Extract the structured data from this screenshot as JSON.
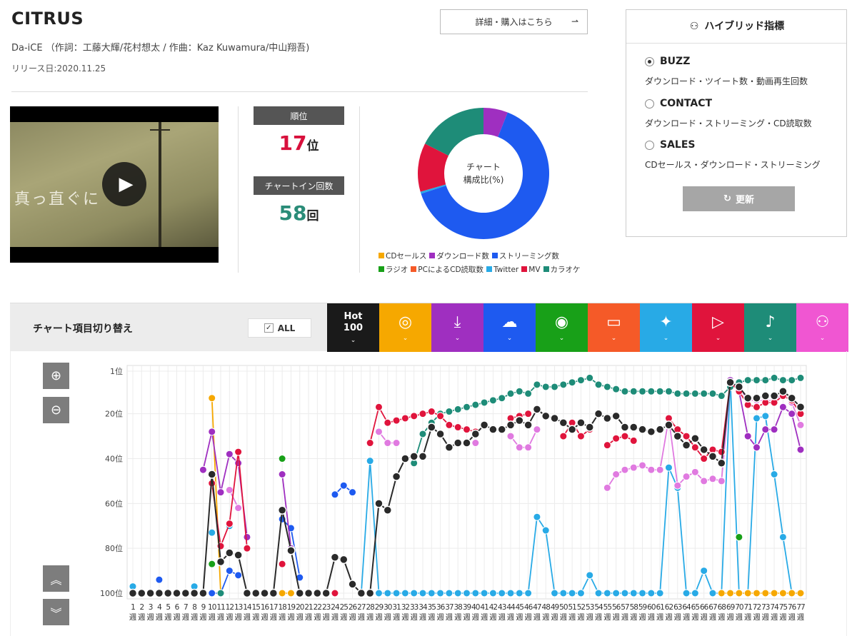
{
  "song": {
    "title": "CITRUS",
    "credits": "Da-iCE （作詞：工藤大輝/花村想太 / 作曲：Kaz Kuwamura/中山翔吾)",
    "release": "リリース日:2020.11.25",
    "buy_label": "詳細・購入はこちら",
    "buy_arrow": "⇀"
  },
  "video": {
    "overlay_text": "真っ直ぐに",
    "play_glyph": "▶"
  },
  "stats": {
    "rank_label": "順位",
    "rank_value": "17",
    "rank_unit": "位",
    "rank_color": "#d8103c",
    "count_label": "チャートイン回数",
    "count_value": "58",
    "count_unit": "回",
    "count_color": "#2a8c78"
  },
  "donut": {
    "center_line1": "チャート",
    "center_line2": "構成比(%)",
    "segments": [
      {
        "name": "CDセールス",
        "color": "#f6a800",
        "value": 0
      },
      {
        "name": "ダウンロード数",
        "color": "#9f2fc0",
        "value": 6
      },
      {
        "name": "ストリーミング数",
        "color": "#1e5af0",
        "value": 64
      },
      {
        "name": "ラジオ",
        "color": "#18a018",
        "value": 0
      },
      {
        "name": "PCによるCD読取数",
        "color": "#f55a28",
        "value": 0
      },
      {
        "name": "Twitter",
        "color": "#28aae6",
        "value": 0.5
      },
      {
        "name": "MV",
        "color": "#e0143c",
        "value": 12
      },
      {
        "name": "カラオケ",
        "color": "#1e8c78",
        "value": 17.5
      }
    ]
  },
  "panel": {
    "title": "ハイブリッド指標",
    "options": [
      {
        "label": "BUZZ",
        "desc": "ダウンロード・ツイート数・動画再生回数",
        "selected": true
      },
      {
        "label": "CONTACT",
        "desc": "ダウンロード・ストリーミング・CD読取数",
        "selected": false
      },
      {
        "label": "SALES",
        "desc": "CDセールス・ダウンロード・ストリーミング",
        "selected": false
      }
    ],
    "refresh_label": "更新",
    "refresh_icon": "↻"
  },
  "toggle": {
    "title": "チャート項目切り替え",
    "all_label": "ALL",
    "all_check": "✓",
    "hot_line1": "Hot",
    "hot_line2": "100",
    "chevron": "⌄",
    "tiles": [
      {
        "key": "hot100",
        "color": "#1a1a1a",
        "icon": ""
      },
      {
        "key": "cd-sales",
        "color": "#f6a800",
        "icon": "◎"
      },
      {
        "key": "download",
        "color": "#9f2fc0",
        "icon": "⤓"
      },
      {
        "key": "streaming",
        "color": "#1e5af0",
        "icon": "☁"
      },
      {
        "key": "radio",
        "color": "#18a018",
        "icon": "◉"
      },
      {
        "key": "pc-cd",
        "color": "#f55a28",
        "icon": "▭"
      },
      {
        "key": "twitter",
        "color": "#28aae6",
        "icon": "✦"
      },
      {
        "key": "mv",
        "color": "#e0143c",
        "icon": "▷"
      },
      {
        "key": "karaoke",
        "color": "#1e8c78",
        "icon": "♪"
      },
      {
        "key": "hybrid",
        "color": "#f056d2",
        "icon": "⚇"
      }
    ]
  },
  "controls": {
    "zoom_in": "⊕",
    "zoom_out": "⊖",
    "scroll_up": "︽",
    "scroll_down": "︾"
  },
  "chart_data": {
    "type": "line",
    "y_reversed": true,
    "ylim": [
      1,
      100
    ],
    "ytick_labels": [
      "1位",
      "20位",
      "40位",
      "60位",
      "80位",
      "100位"
    ],
    "ytick_values": [
      1,
      20,
      40,
      60,
      80,
      100
    ],
    "x_labels": [
      "1週",
      "2週",
      "3週",
      "4週",
      "5週",
      "6週",
      "7週",
      "8週",
      "9週",
      "10週",
      "11週",
      "12週",
      "13週",
      "14週",
      "15週",
      "16週",
      "17週",
      "18週",
      "19週",
      "20週",
      "21週",
      "22週",
      "23週",
      "24週",
      "25週",
      "26週",
      "27週",
      "28週",
      "29週",
      "30週",
      "31週",
      "32週",
      "33週",
      "34週",
      "35週",
      "36週",
      "37週",
      "38週",
      "39週",
      "40週",
      "41週",
      "42週",
      "43週",
      "44週",
      "45週",
      "46週",
      "47週",
      "48週",
      "49週",
      "50週",
      "51週",
      "52週",
      "53週",
      "54週",
      "55週",
      "56週",
      "57週",
      "58週",
      "59週",
      "60週",
      "61週",
      "62週",
      "63週",
      "64週",
      "65週",
      "66週",
      "67週",
      "68週",
      "69週",
      "70週",
      "71週",
      "72週",
      "73週",
      "74週",
      "75週",
      "76週",
      "77週"
    ],
    "series": [
      {
        "key": "hot100",
        "color": "#2a2a2a",
        "values": [
          100,
          100,
          100,
          100,
          100,
          100,
          100,
          100,
          100,
          47,
          86,
          82,
          83,
          100,
          100,
          100,
          100,
          63,
          81,
          100,
          100,
          100,
          100,
          84,
          85,
          96,
          100,
          100,
          60,
          63,
          48,
          40,
          39,
          39,
          26,
          29,
          35,
          33,
          33,
          29,
          25,
          27,
          27,
          25,
          23,
          25,
          18,
          21,
          22,
          24,
          27,
          24,
          26,
          20,
          22,
          21,
          26,
          26,
          27,
          28,
          27,
          25,
          30,
          34,
          31,
          36,
          39,
          42,
          6,
          8,
          13,
          13,
          12,
          12,
          10,
          13,
          17
        ]
      },
      {
        "key": "cd-sales",
        "color": "#f6a800",
        "values": [
          null,
          null,
          null,
          null,
          null,
          null,
          null,
          null,
          null,
          13,
          100,
          null,
          null,
          null,
          null,
          null,
          null,
          100,
          100,
          null,
          null,
          null,
          null,
          null,
          null,
          null,
          null,
          null,
          null,
          null,
          null,
          null,
          null,
          null,
          null,
          null,
          null,
          null,
          null,
          null,
          null,
          null,
          null,
          null,
          null,
          null,
          null,
          null,
          null,
          null,
          null,
          null,
          null,
          null,
          null,
          null,
          null,
          null,
          null,
          null,
          null,
          null,
          null,
          null,
          null,
          null,
          null,
          100,
          100,
          100,
          100,
          100,
          100,
          100,
          100,
          100,
          100
        ]
      },
      {
        "key": "download",
        "color": "#9f2fc0",
        "values": [
          null,
          null,
          null,
          null,
          null,
          null,
          null,
          null,
          45,
          28,
          55,
          38,
          42,
          75,
          null,
          null,
          null,
          47,
          80,
          null,
          null,
          null,
          null,
          null,
          null,
          null,
          null,
          null,
          null,
          null,
          null,
          null,
          null,
          null,
          null,
          null,
          null,
          null,
          null,
          null,
          null,
          null,
          null,
          null,
          null,
          null,
          null,
          null,
          null,
          null,
          null,
          null,
          null,
          null,
          null,
          null,
          null,
          null,
          null,
          null,
          null,
          null,
          null,
          null,
          null,
          null,
          null,
          null,
          5,
          10,
          30,
          35,
          27,
          27,
          17,
          20,
          36
        ]
      },
      {
        "key": "streaming",
        "color": "#1e5af0",
        "values": [
          null,
          null,
          null,
          94,
          null,
          null,
          null,
          null,
          null,
          100,
          100,
          90,
          92,
          null,
          null,
          null,
          null,
          67,
          71,
          93,
          null,
          null,
          null,
          56,
          52,
          55,
          null,
          null,
          null,
          null,
          null,
          null,
          null,
          null,
          null,
          null,
          null,
          null,
          null,
          null,
          null,
          null,
          null,
          null,
          null,
          null,
          null,
          null,
          null,
          null,
          null,
          null,
          null,
          null,
          null,
          null,
          null,
          null,
          null,
          null,
          null,
          null,
          null,
          null,
          null,
          null,
          null,
          null,
          7,
          null,
          null,
          null,
          null,
          null,
          null,
          null,
          null
        ]
      },
      {
        "key": "radio",
        "color": "#18a018",
        "values": [
          null,
          null,
          null,
          null,
          null,
          null,
          null,
          null,
          null,
          87,
          null,
          null,
          null,
          null,
          null,
          null,
          null,
          40,
          null,
          null,
          null,
          null,
          null,
          null,
          null,
          null,
          null,
          null,
          null,
          null,
          null,
          null,
          null,
          null,
          null,
          null,
          null,
          null,
          null,
          null,
          null,
          null,
          null,
          null,
          null,
          null,
          null,
          null,
          null,
          null,
          null,
          null,
          null,
          null,
          null,
          null,
          null,
          null,
          null,
          null,
          null,
          null,
          null,
          null,
          null,
          null,
          null,
          null,
          null,
          75,
          null,
          null,
          null,
          null,
          null,
          null,
          null
        ]
      },
      {
        "key": "twitter",
        "color": "#28aae6",
        "values": [
          97,
          null,
          null,
          null,
          null,
          null,
          null,
          97,
          null,
          73,
          null,
          70,
          null,
          null,
          null,
          null,
          null,
          null,
          null,
          null,
          null,
          null,
          null,
          null,
          null,
          null,
          100,
          41,
          100,
          100,
          100,
          100,
          100,
          100,
          100,
          100,
          100,
          100,
          100,
          100,
          100,
          100,
          100,
          100,
          100,
          100,
          66,
          72,
          100,
          100,
          100,
          100,
          92,
          100,
          100,
          100,
          100,
          100,
          100,
          100,
          100,
          44,
          53,
          100,
          100,
          90,
          100,
          100,
          5,
          100,
          100,
          22,
          21,
          47,
          75,
          100,
          100
        ]
      },
      {
        "key": "mv",
        "color": "#e0143c",
        "values": [
          null,
          null,
          null,
          null,
          null,
          null,
          null,
          null,
          null,
          51,
          79,
          69,
          37,
          80,
          null,
          null,
          null,
          87,
          null,
          null,
          null,
          null,
          null,
          100,
          null,
          null,
          null,
          33,
          17,
          24,
          23,
          22,
          21,
          20,
          19,
          21,
          25,
          26,
          27,
          28,
          null,
          null,
          null,
          22,
          21,
          20,
          null,
          null,
          null,
          30,
          24,
          30,
          27,
          null,
          34,
          31,
          30,
          32,
          null,
          28,
          null,
          22,
          27,
          30,
          35,
          40,
          36,
          37,
          6,
          10,
          16,
          17,
          15,
          15,
          12,
          14,
          20
        ]
      },
      {
        "key": "karaoke",
        "color": "#1e8c78",
        "values": [
          null,
          null,
          null,
          null,
          null,
          null,
          null,
          null,
          null,
          null,
          100,
          null,
          null,
          null,
          null,
          null,
          null,
          null,
          null,
          null,
          null,
          null,
          null,
          null,
          null,
          null,
          null,
          null,
          null,
          null,
          null,
          null,
          42,
          29,
          24,
          20,
          19,
          18,
          17,
          16,
          15,
          14,
          13,
          11,
          10,
          11,
          7,
          8,
          8,
          7,
          6,
          5,
          4,
          7,
          8,
          9,
          10,
          10,
          10,
          10,
          10,
          10,
          11,
          11,
          11,
          11,
          11,
          12,
          8,
          6,
          5,
          5,
          5,
          4,
          5,
          5,
          4
        ]
      },
      {
        "key": "hybrid",
        "color": "#e07ae0",
        "values": [
          null,
          null,
          null,
          null,
          null,
          null,
          null,
          null,
          null,
          null,
          null,
          54,
          62,
          null,
          null,
          null,
          null,
          null,
          null,
          null,
          null,
          null,
          null,
          null,
          null,
          null,
          null,
          null,
          28,
          33,
          33,
          null,
          null,
          null,
          null,
          null,
          null,
          null,
          null,
          33,
          null,
          null,
          null,
          30,
          35,
          35,
          27,
          null,
          null,
          null,
          null,
          null,
          null,
          null,
          53,
          47,
          45,
          44,
          43,
          45,
          45,
          22,
          52,
          48,
          46,
          50,
          49,
          50,
          6,
          8,
          14,
          14,
          14,
          14,
          11,
          15,
          25
        ]
      }
    ]
  }
}
